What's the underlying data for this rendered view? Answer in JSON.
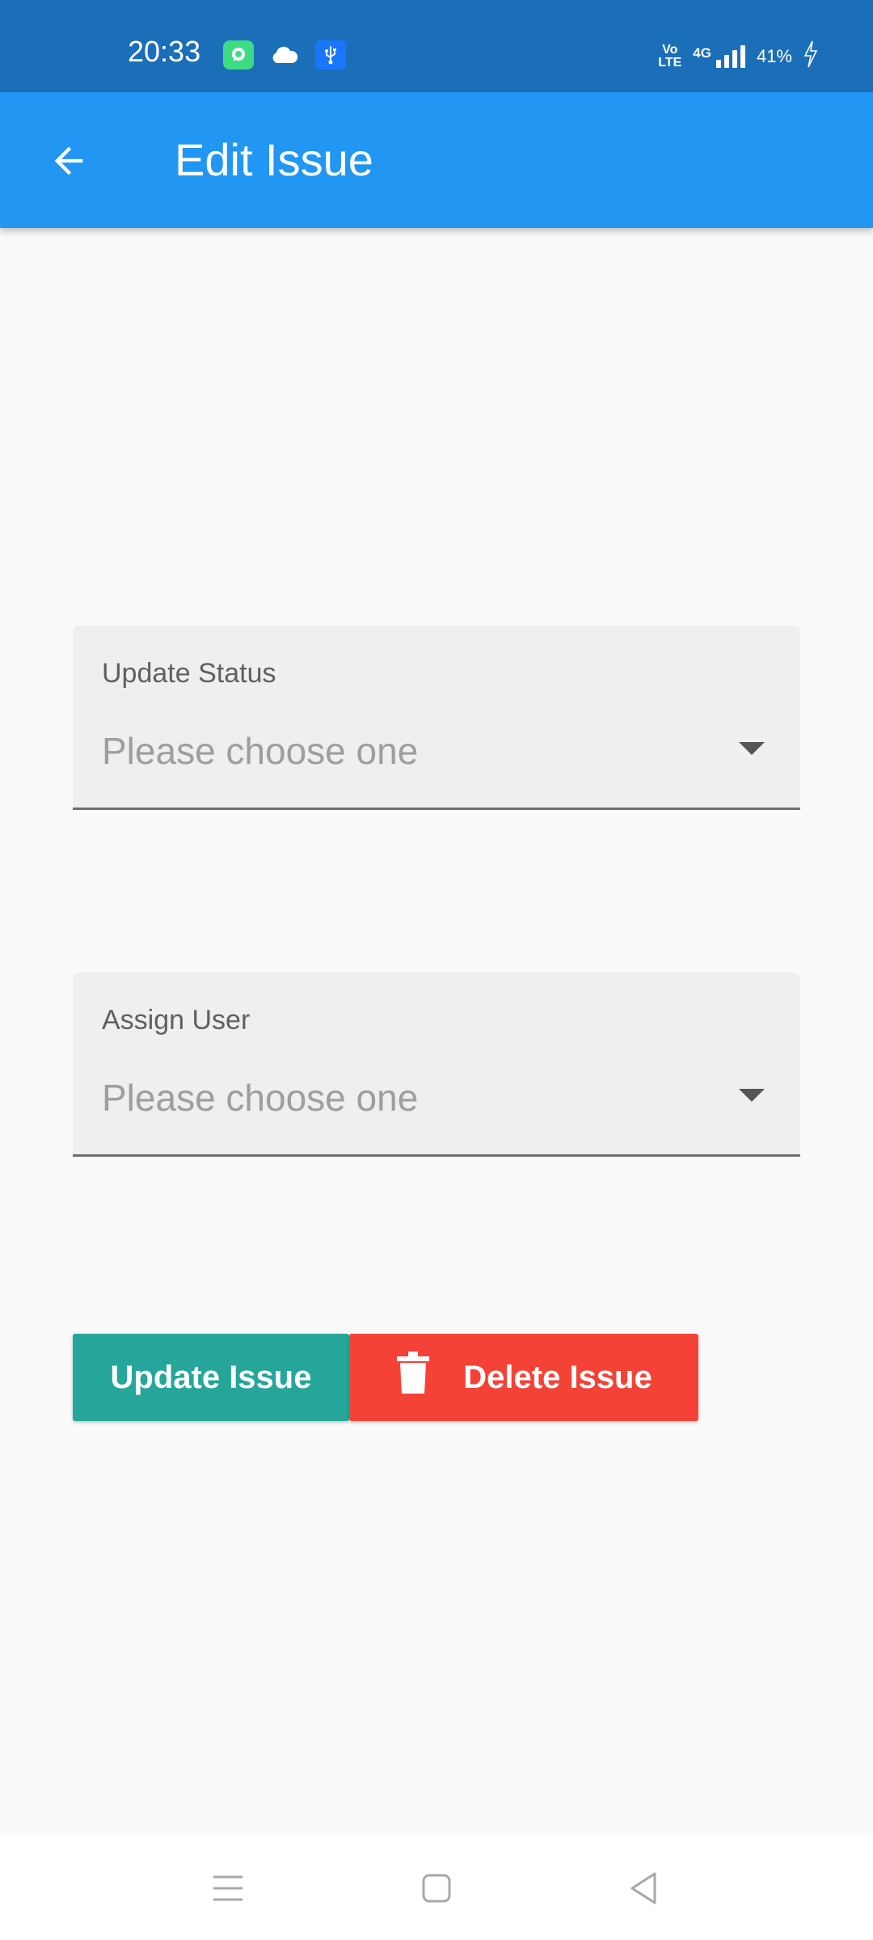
{
  "status_bar": {
    "time": "20:33",
    "network_label": "4G",
    "volte_label_top": "Vo",
    "volte_label_bottom": "LTE",
    "battery_percent": "41%",
    "icons": [
      "chat-icon",
      "cloud-icon",
      "usb-icon",
      "volte-icon",
      "signal-icon",
      "charging-icon"
    ]
  },
  "app_bar": {
    "title": "Edit Issue",
    "back_icon": "arrow-back-icon"
  },
  "form": {
    "status_field": {
      "label": "Update Status",
      "placeholder": "Please choose one"
    },
    "user_field": {
      "label": "Assign User",
      "placeholder": "Please choose one"
    }
  },
  "actions": {
    "update_label": "Update Issue",
    "delete_label": "Delete Issue",
    "delete_icon": "trash-icon"
  },
  "nav_bar": {
    "icons": [
      "menu-icon",
      "home-icon",
      "back-icon"
    ]
  },
  "colors": {
    "status_bar": "#1a6fb8",
    "app_bar": "#2196f3",
    "update_button": "#26a69a",
    "delete_button": "#f44336"
  }
}
